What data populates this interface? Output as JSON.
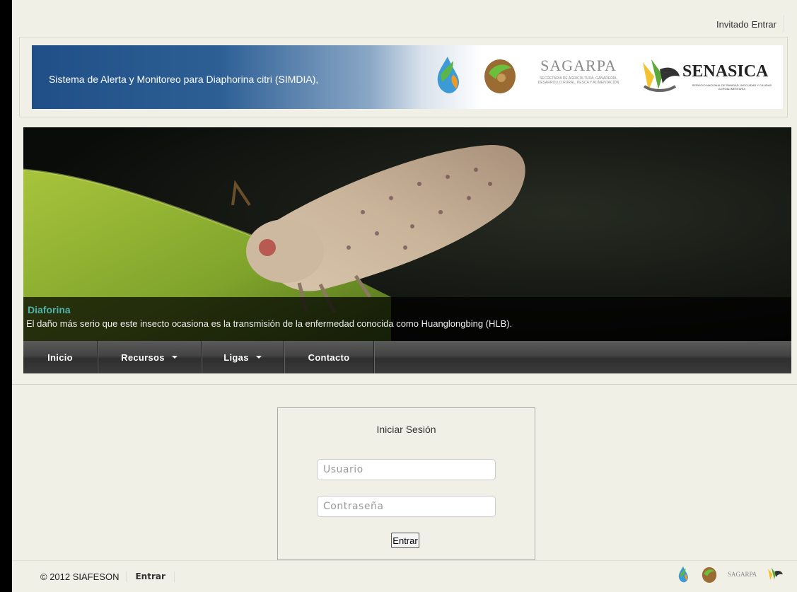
{
  "userbar": {
    "user": "Invitado",
    "login_link": "Entrar"
  },
  "header": {
    "title": "Sistema de Alerta y Monitoreo para Diaphorina citri (SIMDIA),",
    "sagarpa": {
      "name": "SAGARPA",
      "subtitle": "SECRETARÍA DE AGRICULTURA, GANADERÍA, DESARROLLO RURAL, PESCA Y ALIMENTACIÓN"
    },
    "senasica": {
      "name": "SENASICA",
      "subtitle": "SERVICIO NACIONAL DE SANIDAD, INOCUIDAD Y CALIDAD AGROALIMENTARIA"
    }
  },
  "hero": {
    "caption_title": "Diaforina",
    "caption_text": "El daño más serio que este insecto ocasiona es la transmisión de la enfermedad conocida como Huanglongbing (HLB)."
  },
  "nav": {
    "items": [
      {
        "label": "Inicio",
        "dropdown": false
      },
      {
        "label": "Recursos",
        "dropdown": true
      },
      {
        "label": "Ligas",
        "dropdown": true
      },
      {
        "label": "Contacto",
        "dropdown": false
      }
    ]
  },
  "login": {
    "title": "Iniciar Sesión",
    "username_placeholder": "Usuario",
    "password_placeholder": "Contraseña",
    "submit_label": "Entrar"
  },
  "footer": {
    "copyright": "© 2012 SIAFESON",
    "login_link": "Entrar",
    "sagarpa_mini": "SAGARPA"
  }
}
